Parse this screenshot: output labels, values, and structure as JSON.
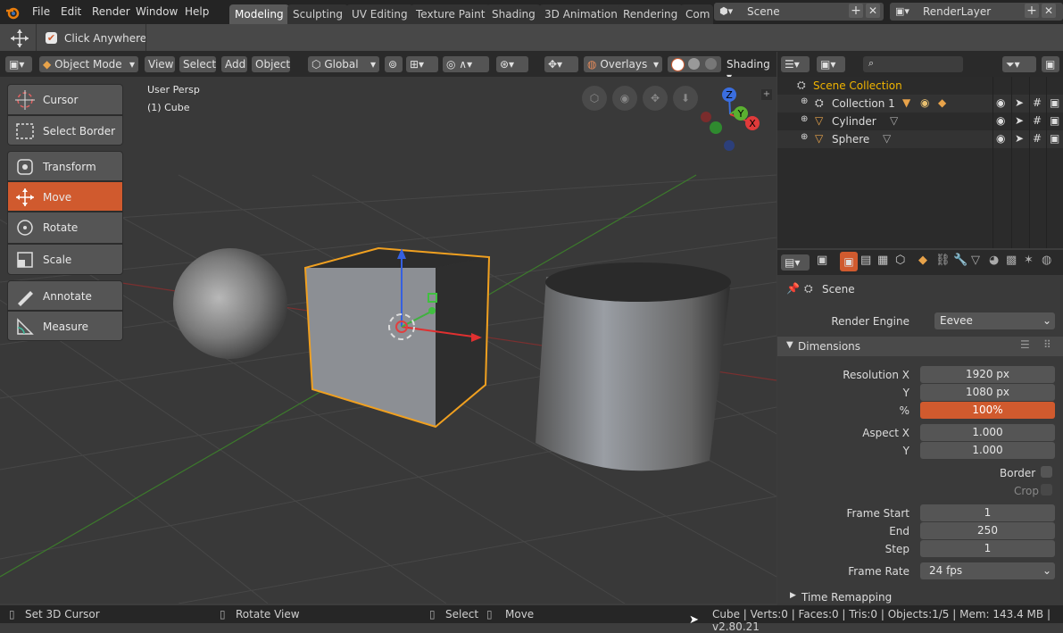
{
  "menu": [
    "File",
    "Edit",
    "Render",
    "Window",
    "Help"
  ],
  "workspaces": [
    "Modeling",
    "Sculpting",
    "UV Editing",
    "Texture Paint",
    "Shading",
    "3D Animation",
    "Rendering",
    "Com"
  ],
  "scene_field": "Scene",
  "renderlayer_field": "RenderLayer",
  "tool_settings": {
    "option_label": "Click Anywhere",
    "checked": true
  },
  "viewport_header": {
    "mode": "Object Mode",
    "menus": [
      "View",
      "Select",
      "Add",
      "Object"
    ],
    "orientation": "Global",
    "overlays": "Overlays",
    "shading": "Shading"
  },
  "viewport": {
    "view_name": "User Persp",
    "object_name": "(1) Cube"
  },
  "tools": [
    {
      "label": "Cursor",
      "icon": "cursor-icon",
      "active": false
    },
    {
      "label": "Select Border",
      "icon": "select-border-icon",
      "active": false
    },
    {
      "label": "Transform",
      "icon": "transform-icon",
      "active": false
    },
    {
      "label": "Move",
      "icon": "move-icon",
      "active": true
    },
    {
      "label": "Rotate",
      "icon": "rotate-icon",
      "active": false
    },
    {
      "label": "Scale",
      "icon": "scale-icon",
      "active": false
    },
    {
      "label": "Annotate",
      "icon": "annotate-icon",
      "active": false
    },
    {
      "label": "Measure",
      "icon": "measure-icon",
      "active": false
    }
  ],
  "gizmo": {
    "z": "Z",
    "y": "Y",
    "x": "X"
  },
  "outliner": {
    "root": "Scene Collection",
    "items": [
      {
        "label": "Collection 1"
      },
      {
        "label": "Cylinder"
      },
      {
        "label": "Sphere"
      }
    ]
  },
  "properties": {
    "context": "Scene",
    "render_engine_label": "Render Engine",
    "render_engine_value": "Eevee",
    "section_dimensions": "Dimensions",
    "resolution_x_label": "Resolution X",
    "resolution_x": "1920 px",
    "resolution_y_label": "Y",
    "resolution_y": "1080 px",
    "percent_label": "%",
    "percent": "100%",
    "aspect_x_label": "Aspect X",
    "aspect_x": "1.000",
    "aspect_y_label": "Y",
    "aspect_y": "1.000",
    "border_label": "Border",
    "crop_label": "Crop",
    "frame_start_label": "Frame Start",
    "frame_start": "1",
    "end_label": "End",
    "end": "250",
    "step_label": "Step",
    "step": "1",
    "frame_rate_label": "Frame Rate",
    "frame_rate": "24 fps",
    "section_time_remapping": "Time Remapping"
  },
  "status": {
    "left": "Set 3D Cursor",
    "middle": "Rotate View",
    "select": "Select",
    "move": "Move",
    "stats": "Cube | Verts:0 | Faces:0 | Tris:0 | Objects:1/5 | Mem: 143.4 MB | v2.80.21"
  },
  "colors": {
    "accent": "#d05a2e",
    "selected_outline": "#f0a020",
    "outliner_root": "#f0b400"
  }
}
